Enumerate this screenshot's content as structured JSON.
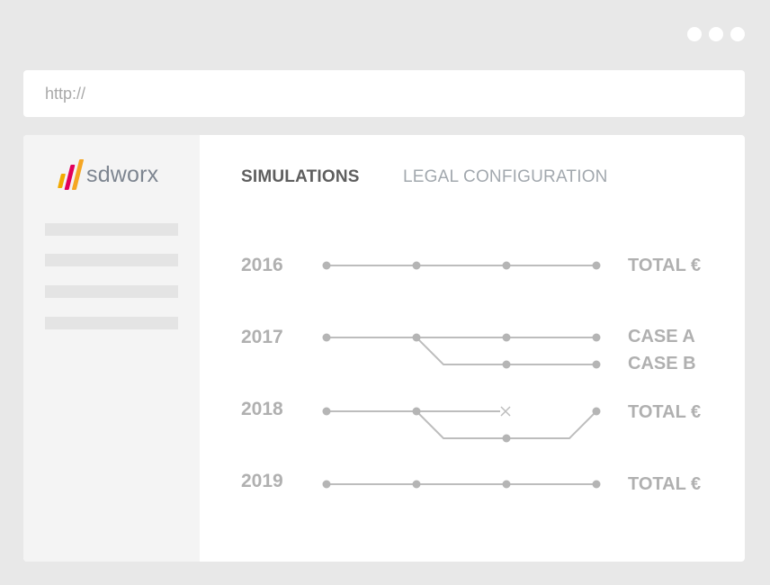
{
  "browser": {
    "url": "http://"
  },
  "logo": {
    "text": "sdworx",
    "bar_colors": [
      "#f2a900",
      "#e2005a",
      "#f5a623"
    ]
  },
  "tabs": [
    {
      "label": "SIMULATIONS",
      "active": true
    },
    {
      "label": "LEGAL CONFIGURATION",
      "active": false
    }
  ],
  "rows": [
    {
      "year": "2016",
      "labels": [
        "TOTAL €"
      ]
    },
    {
      "year": "2017",
      "labels": [
        "CASE A",
        "CASE B"
      ]
    },
    {
      "year": "2018",
      "labels": [
        "TOTAL €"
      ]
    },
    {
      "year": "2019",
      "labels": [
        "TOTAL €"
      ]
    }
  ],
  "colors": {
    "line": "#bdbdbd",
    "node": "#b5b5b5",
    "text_muted": "#b0b0b0",
    "tab_active": "#5e5e5e",
    "tab_inactive": "#a2a8ae",
    "sidebar_bg": "#f4f4f4",
    "frame_bg": "#e8e8e8"
  }
}
